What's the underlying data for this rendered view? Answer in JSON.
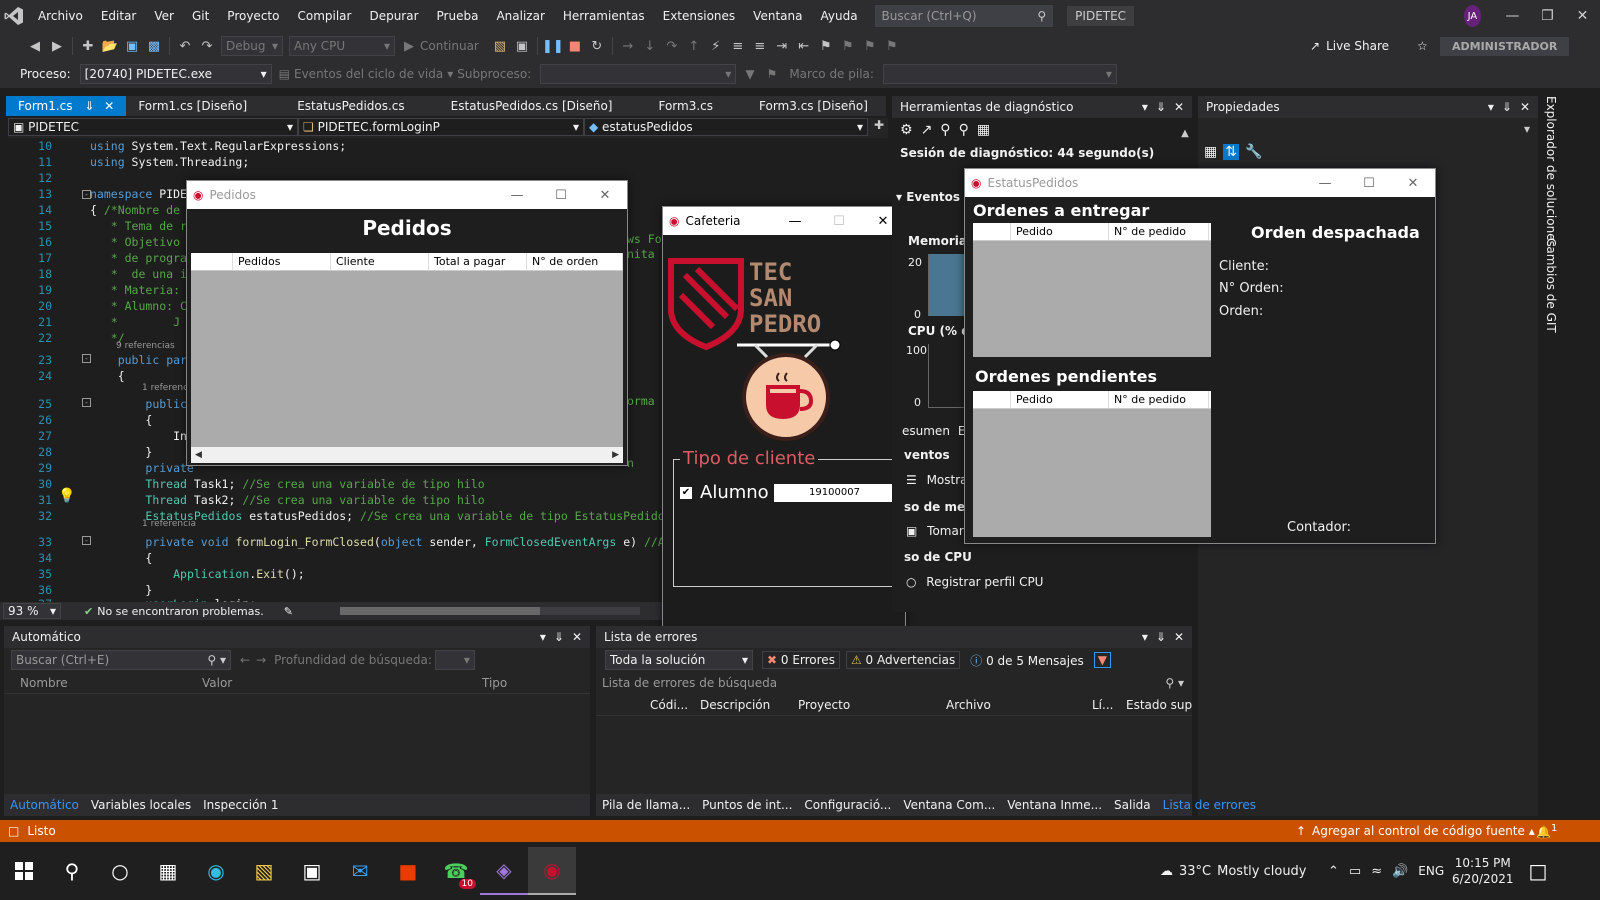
{
  "menubar": {
    "items": [
      "Archivo",
      "Editar",
      "Ver",
      "Git",
      "Proyecto",
      "Compilar",
      "Depurar",
      "Prueba",
      "Analizar",
      "Herramientas",
      "Extensiones",
      "Ventana",
      "Ayuda"
    ],
    "search_placeholder": "Buscar (Ctrl+Q)",
    "solution_title": "PIDETEC",
    "avatar_initials": "JA"
  },
  "toolbar": {
    "config": "Debug",
    "platform": "Any CPU",
    "continue_label": "Continuar",
    "live_share": "Live Share",
    "admin_badge": "ADMINISTRADOR",
    "process_label": "Proceso:",
    "process_value": "[20740] PIDETEC.exe",
    "lifecycle_events": "Eventos del ciclo de vida",
    "thread_label": "Subproceso:",
    "stack_frame_label": "Marco de pila:"
  },
  "editor": {
    "tabs": [
      "Form1.cs",
      "Form1.cs [Diseño]",
      "EstatusPedidos.cs",
      "EstatusPedidos.cs [Diseño]",
      "Form3.cs",
      "Form3.cs [Diseño]"
    ],
    "nav_project": "PIDETEC",
    "nav_class": "PIDETEC.formLoginP",
    "nav_member": "estatusPedidos",
    "zoom": "93 %",
    "problems": "No se encontraron problemas."
  },
  "code_lines": [
    {
      "n": "10",
      "html": "<span class='kw'>using</span> System.Text.RegularExpressions;"
    },
    {
      "n": "11",
      "html": "<span class='kw'>using</span> System.Threading;"
    },
    {
      "n": "12",
      "html": ""
    },
    {
      "n": "13",
      "html": "<span class='kw'>namespace</span> PIDE"
    },
    {
      "n": "14",
      "html": "{ <span class='cm'>/*Nombre de</span>"
    },
    {
      "n": "15",
      "html": "<span class='cm'>   * Tema de r</span>"
    },
    {
      "n": "16",
      "html": "<span class='cm'>   * Objetivo</span>"
    },
    {
      "n": "17",
      "html": "<span class='cm'>   * de progra</span>"
    },
    {
      "n": "18",
      "html": "<span class='cm'>   *  de una i</span>"
    },
    {
      "n": "19",
      "html": "<span class='cm'>   * Materia:</span>"
    },
    {
      "n": "20",
      "html": "<span class='cm'>   * Alumno: C</span>"
    },
    {
      "n": "21",
      "html": "<span class='cm'>   *        J</span>"
    },
    {
      "n": "22",
      "html": "<span class='cm'>   */</span>"
    },
    {
      "n": "23",
      "html": "    <span class='kw'>public</span> <span class='kw'>part</span>"
    },
    {
      "n": "24",
      "html": "    {"
    },
    {
      "n": "25",
      "html": "        <span class='kw'>public</span>"
    },
    {
      "n": "26",
      "html": "        {"
    },
    {
      "n": "27",
      "html": "            Ini"
    },
    {
      "n": "28",
      "html": "        }"
    },
    {
      "n": "29",
      "html": "        <span class='kw'>private</span>"
    },
    {
      "n": "30",
      "html": "        <span class='ty'>Thread</span> Task1; <span class='cm'>//Se crea una variable de tipo hilo</span>"
    },
    {
      "n": "31",
      "html": "        <span class='ty'>Thread</span> Task2; <span class='cm'>//Se crea una variable de tipo hilo</span>"
    },
    {
      "n": "32",
      "html": "        <span class='ty'>EstatusPedidos</span> estatusPedidos; <span class='cm'>//Se crea una variable de tipo EstatusPedidos</span>"
    },
    {
      "n": "33",
      "html": "        <span class='kw'>private</span> <span class='kw'>void</span> <span class='mt'>formLogin_FormClosed</span>(<span class='kw'>object</span> sender, <span class='ty'>FormClosedEventArgs</span> e) <span class='cm'>//Al pre</span>"
    },
    {
      "n": "34",
      "html": "        {"
    },
    {
      "n": "35",
      "html": "            <span class='ty'>Application</span>.<span class='mt'>Exit</span>();"
    },
    {
      "n": "36",
      "html": "        }"
    },
    {
      "n": "37",
      "html": "        <span class='ty'>userLogin</span> login;"
    }
  ],
  "code_refs": {
    "r9": "9 referencias",
    "r1": "1 referencia",
    "r1b": "1 referencia",
    "r1c": "1 referencia"
  },
  "code_fragments": {
    "f17": "ws For",
    "f18": "nita t",
    "f25": "orma",
    "f29": "n"
  },
  "pedidos_window": {
    "title": "Pedidos",
    "heading": "Pedidos",
    "columns": [
      "Pedidos",
      "Cliente",
      "Total a pagar",
      "N° de orden"
    ]
  },
  "cafeteria_window": {
    "title": "Cafeteria",
    "logo_lines": [
      "TEC",
      "SAN",
      "PEDRO"
    ],
    "group_label": "Tipo de cliente",
    "checkbox_label": "Alumno",
    "student_id": "19100007"
  },
  "estatus_window": {
    "title": "EstatusPedidos",
    "to_deliver": "Ordenes a entregar",
    "pending": "Ordenes pendientes",
    "columns": [
      "Pedido",
      "N° de pedido"
    ],
    "dispatched": "Orden despachada",
    "client_label": "Cliente:",
    "order_num_label": "N° Orden:",
    "order_label": "Orden:",
    "counter_label": "Contador:"
  },
  "diagnostics": {
    "title": "Herramientas de diagnóstico",
    "session": "Sesión de diagnóstico: 44 segundo(s)",
    "events": "Eventos",
    "memory": "Memoria d",
    "mem_max": "20",
    "mem_min": "0",
    "cpu": "CPU (% de",
    "cpu_max": "100",
    "cpu_min": "0",
    "tab_summary": "esumen",
    "tab_e": "E",
    "events_label": "ventos",
    "show": "Mostra",
    "mem_use": "so de mem",
    "take": "Tomar",
    "cpu_use": "so de CPU",
    "cpu_profile": "Registrar perfil CPU"
  },
  "properties": {
    "title": "Propiedades"
  },
  "side_tabs": {
    "solution_explorer": "Explorador de soluciones",
    "git_changes": "Cambios de GIT"
  },
  "autos_panel": {
    "title": "Automático",
    "search": "Buscar (Ctrl+E)",
    "depth": "Profundidad de búsqueda:",
    "cols": [
      "Nombre",
      "Valor",
      "Tipo"
    ],
    "tabs": [
      "Automático",
      "Variables locales",
      "Inspección 1"
    ]
  },
  "errors_panel": {
    "title": "Lista de errores",
    "scope": "Toda la solución",
    "errors": "0 Errores",
    "warnings": "0 Advertencias",
    "messages": "0 de 5 Mensajes",
    "search": "Lista de errores de búsqueda",
    "cols": [
      "Códi...",
      "Descripción",
      "Proyecto",
      "Archivo",
      "Lí...",
      "Estado supr"
    ],
    "tabs": [
      "Pila de llama...",
      "Puntos de int...",
      "Configuració...",
      "Ventana Com...",
      "Ventana Inme...",
      "Salida",
      "Lista de errores"
    ]
  },
  "statusbar": {
    "ready": "Listo",
    "source_control": "Agregar al control de código fuente",
    "notif_count": "1"
  },
  "taskbar": {
    "weather_temp": "33°C",
    "weather_desc": "Mostly cloudy",
    "lang": "ENG",
    "time": "10:15 PM",
    "date": "6/20/2021",
    "whatsapp_badge": "10"
  },
  "colors": {
    "accent": "#007acc",
    "status": "#ca5100",
    "brand_red": "#c8102e"
  }
}
